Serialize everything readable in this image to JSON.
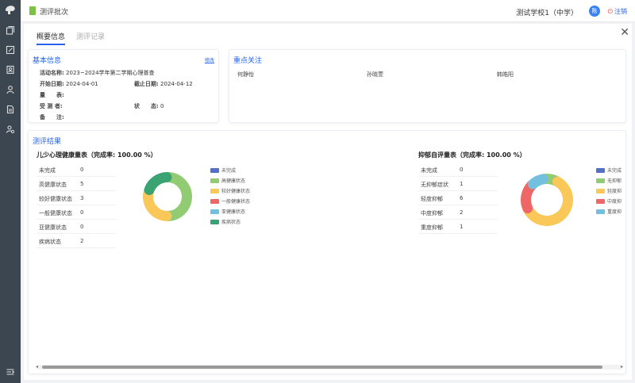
{
  "topbar": {
    "title": "测评批次",
    "school": "测试学校1（中学）",
    "avatar": "陈",
    "logout": "注销"
  },
  "tabs": [
    {
      "label": "概要信息",
      "active": true
    },
    {
      "label": "测评记录",
      "active": false
    }
  ],
  "basic_info": {
    "title": "基本信息",
    "edit_link": "修改",
    "activity_label": "活动名称:",
    "activity_value": "2023~2024学年第二学期心理普查",
    "start_label": "开始日期:",
    "start_value": "2024-04-01",
    "end_label": "截止日期:",
    "end_value": "2024-04-12",
    "scale_label": "量　　表:",
    "scale_value": "",
    "subjects_label": "受 测 者:",
    "subjects_value": "",
    "status_label": "状　　态:",
    "status_value": "0",
    "remark_label": "备　　注:",
    "remark_value": ""
  },
  "focus": {
    "title": "重点关注",
    "names": [
      "何静怡",
      "孙晓萱",
      "韩皓阳"
    ]
  },
  "results": {
    "title": "测评结果",
    "left": {
      "heading": "儿少心理健康量表（完成率: 100.00 %）",
      "rows": [
        {
          "label": "未完成",
          "value": "0"
        },
        {
          "label": "高健康状态",
          "value": "5"
        },
        {
          "label": "较好健康状态",
          "value": "3"
        },
        {
          "label": "一般健康状态",
          "value": "0"
        },
        {
          "label": "亚健康状态",
          "value": "0"
        },
        {
          "label": "疾病状态",
          "value": "2"
        }
      ],
      "legend": [
        "未完成",
        "高健康状态",
        "较好健康状态",
        "一般健康状态",
        "亚健康状态",
        "疾病状态"
      ]
    },
    "right": {
      "heading": "抑郁自评量表（完成率: 100.00 %）",
      "rows": [
        {
          "label": "未完成",
          "value": "0"
        },
        {
          "label": "无抑郁症状",
          "value": "1"
        },
        {
          "label": "轻度抑郁",
          "value": "6"
        },
        {
          "label": "中度抑郁",
          "value": "2"
        },
        {
          "label": "重度抑郁",
          "value": "1"
        }
      ],
      "legend": [
        "未完成",
        "无抑郁",
        "轻度抑",
        "中度抑",
        "重度抑"
      ]
    }
  },
  "chart_data": [
    {
      "type": "pie",
      "categories": [
        "未完成",
        "高健康状态",
        "较好健康状态",
        "一般健康状态",
        "亚健康状态",
        "疾病状态"
      ],
      "values": [
        0,
        5,
        3,
        0,
        0,
        2
      ],
      "colors": [
        "#5470c6",
        "#91cc75",
        "#fac858",
        "#ee6666",
        "#73c0de",
        "#3ba272"
      ]
    },
    {
      "type": "pie",
      "categories": [
        "未完成",
        "无抑郁症状",
        "轻度抑郁",
        "中度抑郁",
        "重度抑郁"
      ],
      "values": [
        0,
        1,
        6,
        2,
        1
      ],
      "colors": [
        "#5470c6",
        "#91cc75",
        "#fac858",
        "#ee6666",
        "#73c0de"
      ]
    }
  ],
  "icons": {
    "logo": "brand-logo-icon",
    "sidebar": [
      "copy-icon",
      "edit-icon",
      "contact-card-icon",
      "user-icon",
      "document-icon",
      "users-gear-icon"
    ],
    "collapse": "collapse-sidebar-icon",
    "close": "close-icon"
  }
}
